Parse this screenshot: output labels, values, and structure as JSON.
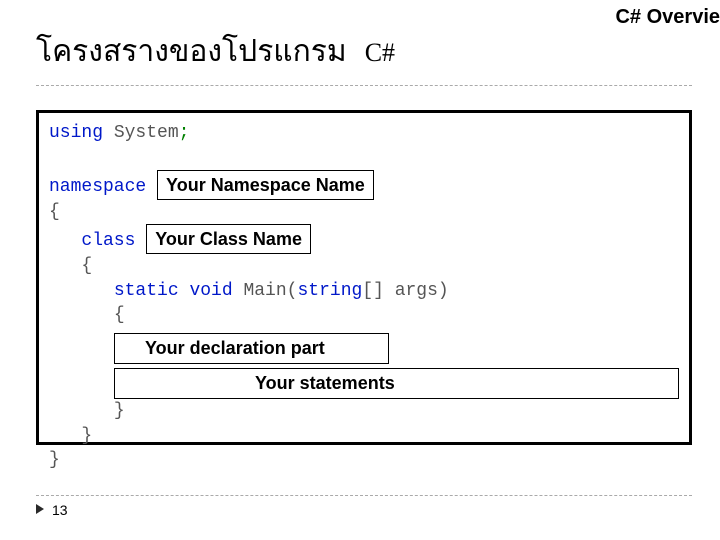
{
  "header": {
    "title_thai": "โครงสรางของโปรแกรม",
    "title_en": "C#",
    "overview": "C# Overvie"
  },
  "code": {
    "kw_using": "using",
    "sys": " System",
    "semicolon": ";",
    "kw_namespace": "namespace",
    "placeholder_namespace": "Your Namespace Name",
    "brace_open": "{",
    "kw_class": "class",
    "placeholder_class": "Your Class Name",
    "brace_open2": "{",
    "kw_static": "static",
    "kw_void": "void",
    "main_sig_name": " Main",
    "main_sig_open": "(",
    "kw_string": "string",
    "main_sig_rest": "[] args)",
    "brace_open3": "{",
    "placeholder_decl": "Your declaration part",
    "placeholder_stmt": "Your statements",
    "brace_close3": "}",
    "brace_close2": "}",
    "brace_close": "}"
  },
  "footer": {
    "page": "13"
  }
}
